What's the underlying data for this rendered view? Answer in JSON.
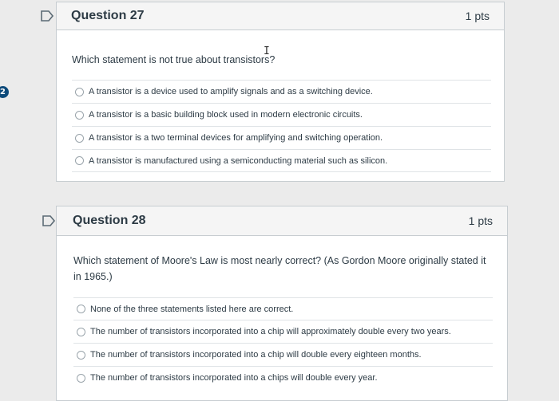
{
  "side_badge": "2",
  "questions": [
    {
      "title": "Question 27",
      "points": "1 pts",
      "text": "Which statement is not true about transistors?",
      "answers": [
        "A transistor is a device used to amplify signals and as a switching device.",
        "A transistor is a basic building block used in modern electronic circuits.",
        "A transistor is a two terminal devices for amplifying and switching operation.",
        "A transistor is manufactured using a semiconducting material such as silicon."
      ]
    },
    {
      "title": "Question 28",
      "points": "1 pts",
      "text": "Which statement of Moore's Law is most nearly correct? (As Gordon Moore originally stated it in 1965.)",
      "answers": [
        "None of the three statements listed here are correct.",
        "The number of transistors incorporated into a chip will approximately double every two years.",
        "The number of transistors incorporated into a chip will double every eighteen months.",
        "The number of transistors incorporated into a chips will double every year."
      ]
    }
  ]
}
